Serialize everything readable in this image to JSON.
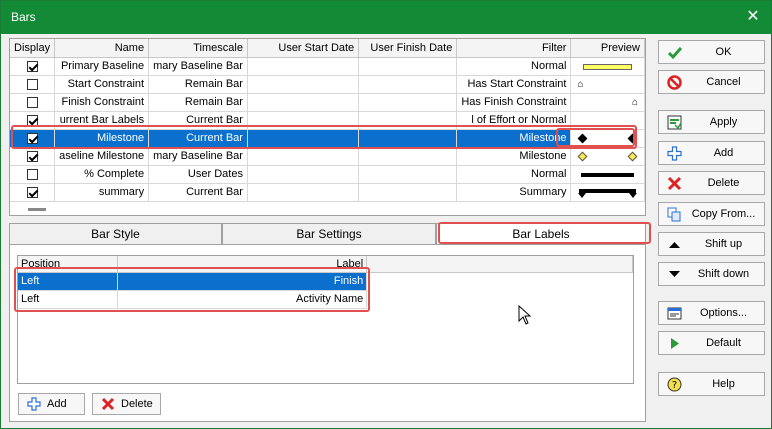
{
  "window": {
    "title": "Bars"
  },
  "grid": {
    "columns": [
      "Display",
      "Name",
      "Timescale",
      "User Start Date",
      "User Finish Date",
      "Filter",
      "Preview"
    ],
    "rows": [
      {
        "display": true,
        "name": "Primary Baseline",
        "timescale": "mary Baseline Bar",
        "start": "",
        "finish": "",
        "filter": "Normal",
        "preview": "yellow-bar"
      },
      {
        "display": false,
        "name": "Start Constraint",
        "timescale": "Remain Bar",
        "start": "",
        "finish": "",
        "filter": "Has Start Constraint",
        "preview": "start-marker"
      },
      {
        "display": false,
        "name": "Finish Constraint",
        "timescale": "Remain Bar",
        "start": "",
        "finish": "",
        "filter": "Has Finish Constraint",
        "preview": "finish-marker"
      },
      {
        "display": true,
        "name": "urrent Bar Labels",
        "timescale": "Current Bar",
        "start": "",
        "finish": "",
        "filter": "l of Effort or Normal",
        "preview": "none"
      },
      {
        "display": true,
        "name": "Milestone",
        "timescale": "Current Bar",
        "start": "",
        "finish": "",
        "filter": "Milestone",
        "preview": "black-diamonds",
        "selected": true
      },
      {
        "display": true,
        "name": "aseline Milestone",
        "timescale": "mary Baseline Bar",
        "start": "",
        "finish": "",
        "filter": "Milestone",
        "preview": "yellow-diamonds"
      },
      {
        "display": false,
        "name": "% Complete",
        "timescale": "User Dates",
        "start": "",
        "finish": "",
        "filter": "Normal",
        "preview": "black-bar"
      },
      {
        "display": true,
        "name": "summary",
        "timescale": "Current Bar",
        "start": "",
        "finish": "",
        "filter": "Summary",
        "preview": "summary-bar"
      }
    ]
  },
  "tabs": [
    "Bar Style",
    "Bar Settings",
    "Bar Labels"
  ],
  "active_tab": "Bar Labels",
  "labels": {
    "columns": [
      "Position",
      "Label"
    ],
    "rows": [
      {
        "position": "Left",
        "label": "Finish",
        "selected": true
      },
      {
        "position": "Left",
        "label": "Activity Name",
        "selected": false
      }
    ],
    "add_label": "Add",
    "delete_label": "Delete"
  },
  "buttons": {
    "ok": "OK",
    "cancel": "Cancel",
    "apply": "Apply",
    "add": "Add",
    "delete": "Delete",
    "copy_from": "Copy From...",
    "shift_up": "Shift up",
    "shift_down": "Shift down",
    "options": "Options...",
    "default": "Default",
    "help": "Help"
  },
  "colors": {
    "titlebar": "#138a36",
    "selection": "#0b6fce",
    "highlight": "#e05050"
  }
}
